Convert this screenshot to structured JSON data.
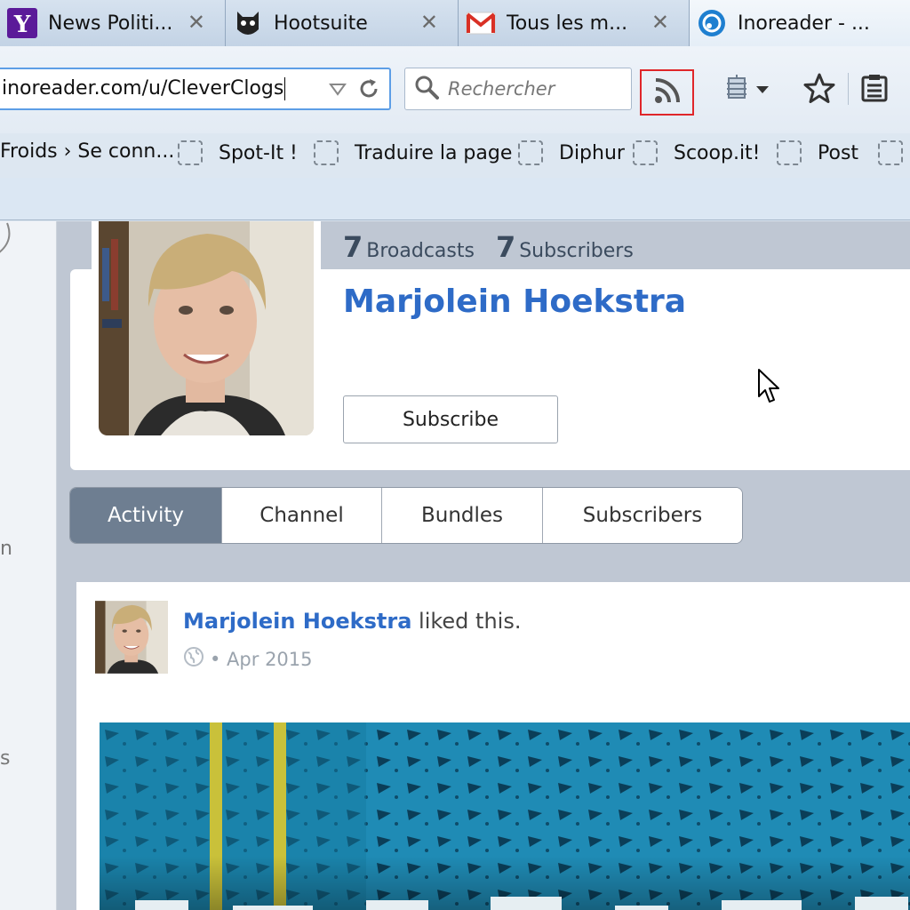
{
  "browser": {
    "tabs": [
      {
        "title": "News Politi...",
        "icon": "yahoo-icon",
        "active": false
      },
      {
        "title": "Hootsuite",
        "icon": "hootsuite-owl-icon",
        "active": false
      },
      {
        "title": "Tous les m...",
        "icon": "gmail-icon",
        "active": false
      },
      {
        "title": "Inoreader - ...",
        "icon": "inoreader-icon",
        "active": true
      }
    ],
    "tab_close_glyph": "✕",
    "url": "inoreader.com/u/CleverClogs",
    "search_placeholder": "Rechercher",
    "bookmarks": [
      "Froids › Se conn...",
      "Spot-It !",
      "Traduire la page",
      "Diphur",
      "Scoop.it!",
      "Post"
    ],
    "colors": {
      "rss_highlight": "#e0262a",
      "url_focus": "#5d9ee6"
    }
  },
  "sidebar": {
    "fragments": [
      "n",
      "s"
    ]
  },
  "profile": {
    "broadcasts_count": "7",
    "broadcasts_label": "Broadcasts",
    "subscribers_count": "7",
    "subscribers_label": "Subscribers",
    "name": "Marjolein Hoekstra",
    "subscribe_label": "Subscribe",
    "accent_color": "#2e6bc7"
  },
  "profile_tabs": [
    {
      "label": "Activity",
      "active": true
    },
    {
      "label": "Channel",
      "active": false
    },
    {
      "label": "Bundles",
      "active": false
    },
    {
      "label": "Subscribers",
      "active": false
    }
  ],
  "feed": {
    "author": "Marjolein Hoekstra",
    "action": " liked this.",
    "date": "• Apr 2015",
    "visibility_icon": "globe-icon"
  }
}
